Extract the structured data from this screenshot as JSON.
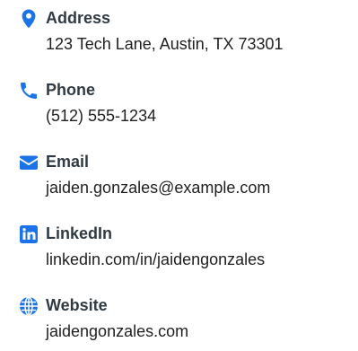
{
  "theme": {
    "accent_color": "#1a73e8",
    "label_color": "#303a42",
    "value_color": "#1f1f1f"
  },
  "contacts": [
    {
      "icon": "map-pin-icon",
      "label": "Address",
      "value": "123 Tech Lane, Austin, TX 73301"
    },
    {
      "icon": "phone-icon",
      "label": "Phone",
      "value": "(512) 555-1234"
    },
    {
      "icon": "envelope-icon",
      "label": "Email",
      "value": "jaiden.gonzales@example.com"
    },
    {
      "icon": "linkedin-icon",
      "label": "LinkedIn",
      "value": "linkedin.com/in/jaidengonzales"
    },
    {
      "icon": "globe-icon",
      "label": "Website",
      "value": "jaidengonzales.com"
    }
  ]
}
